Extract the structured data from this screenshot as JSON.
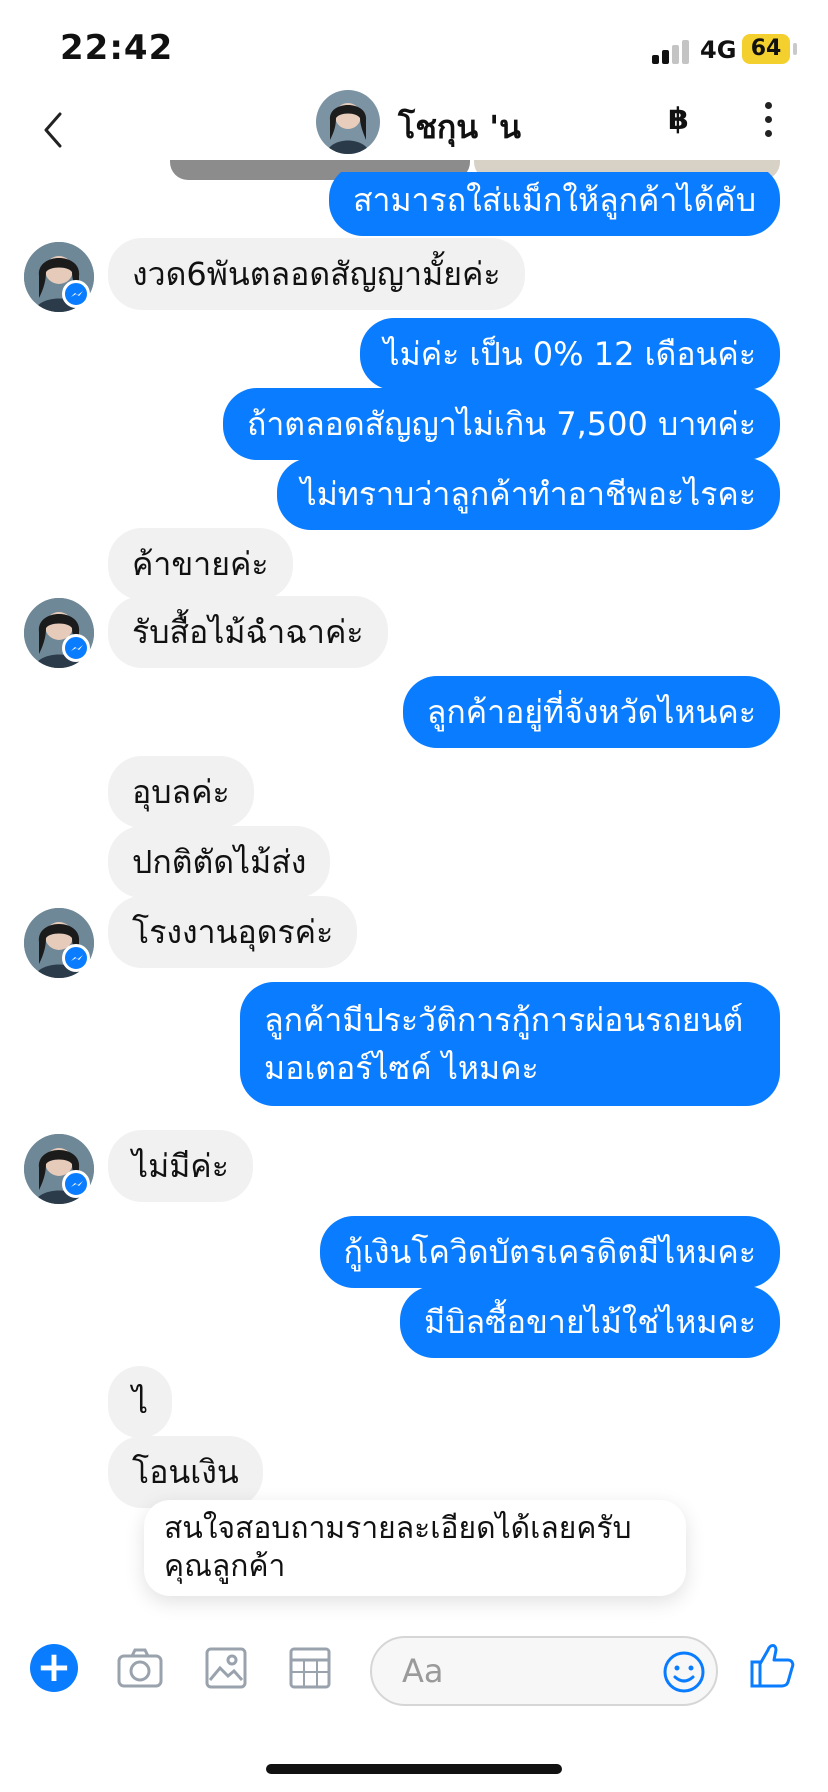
{
  "status_bar": {
    "time": "22:42",
    "network": "4G",
    "battery": "64"
  },
  "header": {
    "contact_name": "โชกุน 'น",
    "baht_symbol": "฿",
    "back_symbol": "‹"
  },
  "messages": [
    {
      "dir": "out",
      "text": "สามารถใส่แม็กให้ลูกค้าได้คับ"
    },
    {
      "dir": "in",
      "text": "งวด6พันตลอดสัญญามั้ยค่ะ"
    },
    {
      "dir": "out",
      "text": "ไม่ค่ะ เป็น 0% 12 เดือนค่ะ"
    },
    {
      "dir": "out",
      "text": "ถ้าตลอดสัญญาไม่เกิน 7,500 บาทค่ะ"
    },
    {
      "dir": "out",
      "text": "ไม่ทราบว่าลูกค้าทำอาชีพอะไรคะ"
    },
    {
      "dir": "in",
      "text": "ค้าขายค่ะ"
    },
    {
      "dir": "in",
      "text": "รับสื้อไม้ฉำฉาค่ะ"
    },
    {
      "dir": "out",
      "text": "ลูกค้าอยู่ที่จังหวัดไหนคะ"
    },
    {
      "dir": "in",
      "text": "อุบลค่ะ"
    },
    {
      "dir": "in",
      "text": "ปกติตัดไม้ส่ง"
    },
    {
      "dir": "in",
      "text": "โรงงานอุดรค่ะ"
    },
    {
      "dir": "out",
      "text": "ลูกค้ามีประวัติการกู้การผ่อนรถยนต์ มอเตอร์ไซค์ ไหมคะ"
    },
    {
      "dir": "in",
      "text": "ไม่มีค่ะ"
    },
    {
      "dir": "out",
      "text": "กู้เงินโควิดบัตรเครดิตมีไหมคะ"
    },
    {
      "dir": "out",
      "text": "มีบิลซื้อขายไม้ใช่ไหมคะ"
    },
    {
      "dir": "in",
      "text": "ไ"
    },
    {
      "dir": "in",
      "text": "โอนเงิน"
    }
  ],
  "toast": {
    "text": "สนใจสอบถามรายละเอียดได้เลยครับ คุณลูกค้า"
  },
  "composer": {
    "placeholder": "Aa",
    "plus_symbol": "+"
  },
  "colors": {
    "accent": "#0a7cff",
    "incoming_bubble": "#f1f1f2",
    "battery": "#f4d02e"
  }
}
